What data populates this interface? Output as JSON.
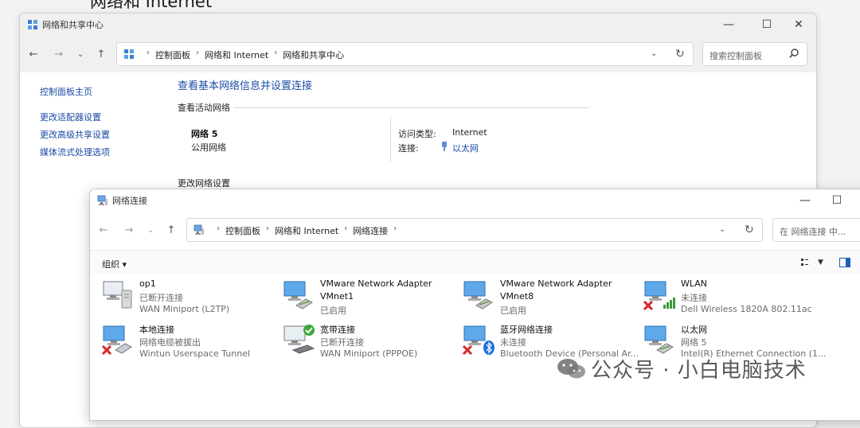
{
  "background_heading": "网络和 Internet",
  "window1": {
    "title": "网络和共享中心",
    "breadcrumbs": [
      "控制面板",
      "网络和 Internet",
      "网络和共享中心"
    ],
    "search_placeholder": "搜索控制面板",
    "left_nav": [
      "控制面板主页",
      "更改适配器设置",
      "更改高级共享设置",
      "媒体流式处理选项"
    ],
    "page_title": "查看基本网络信息并设置连接",
    "active_networks_label": "查看活动网络",
    "network_name": "网络 5",
    "network_category": "公用网络",
    "access_type_label": "访问类型:",
    "access_type_value": "Internet",
    "connections_label": "连接:",
    "connections_value": "以太网",
    "change_settings_label": "更改网络设置"
  },
  "window2": {
    "title": "网络连接",
    "breadcrumbs": [
      "控制面板",
      "网络和 Internet",
      "网络连接"
    ],
    "search_placeholder": "在 网络连接 中...",
    "organize_label": "组织 ▾",
    "items": [
      {
        "name": "op1",
        "status": "已断开连接",
        "device": "WAN Miniport (L2TP)",
        "icon": "vpn-connection-icon"
      },
      {
        "name": "VMware Network Adapter",
        "status": "VMnet1",
        "device": "已启用",
        "icon": "network-adapter-icon"
      },
      {
        "name": "VMware Network Adapter",
        "status": "VMnet8",
        "device": "已启用",
        "icon": "network-adapter-icon"
      },
      {
        "name": "WLAN",
        "status": "未连接",
        "device": "Dell Wireless 1820A 802.11ac",
        "icon": "wlan-adapter-icon"
      },
      {
        "name": "本地连接",
        "status": "网络电缆被拔出",
        "device": "Wintun Userspace Tunnel",
        "icon": "network-adapter-disconnected-icon"
      },
      {
        "name": "宽带连接",
        "status": "已断开连接",
        "device": "WAN Miniport (PPPOE)",
        "icon": "broadband-connection-icon"
      },
      {
        "name": "蓝牙网络连接",
        "status": "未连接",
        "device": "Bluetooth Device (Personal Ar...",
        "icon": "bluetooth-adapter-icon"
      },
      {
        "name": "以太网",
        "status": "网络 5",
        "device": "Intel(R) Ethernet Connection (1...",
        "icon": "ethernet-adapter-icon"
      }
    ]
  },
  "watermark": "公众号 · 小白电脑技术"
}
